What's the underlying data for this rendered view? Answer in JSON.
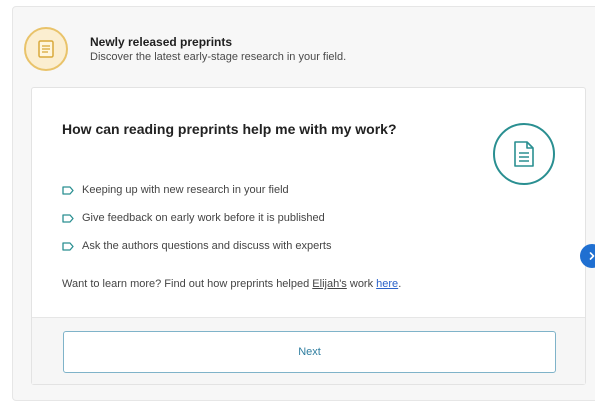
{
  "header": {
    "title": "Newly released preprints",
    "subtitle": "Discover the latest early-stage research in your field.",
    "icon": "document-icon"
  },
  "card": {
    "title": "How can reading preprints help me with my work?",
    "illustration_icon": "document-icon",
    "bullets": [
      {
        "text": "Keeping up with new research in your field",
        "icon": "tag-icon"
      },
      {
        "text": "Give feedback on early work before it is published",
        "icon": "tag-icon"
      },
      {
        "text": "Ask the authors questions and discuss with experts",
        "icon": "tag-icon"
      }
    ],
    "learn_more": {
      "prefix": "Want to learn more? Find out how preprints helped ",
      "name_link": "Elijah's",
      "middle": " work ",
      "here_link": "here",
      "suffix": "."
    },
    "next_label": "Next"
  },
  "carousel": {
    "next_icon": "chevron-right-icon"
  },
  "colors": {
    "accent_teal": "#2a8f91",
    "header_icon_ring": "#e9c36a",
    "link_blue": "#2a62c9",
    "carousel_button": "#1f6fd1"
  }
}
